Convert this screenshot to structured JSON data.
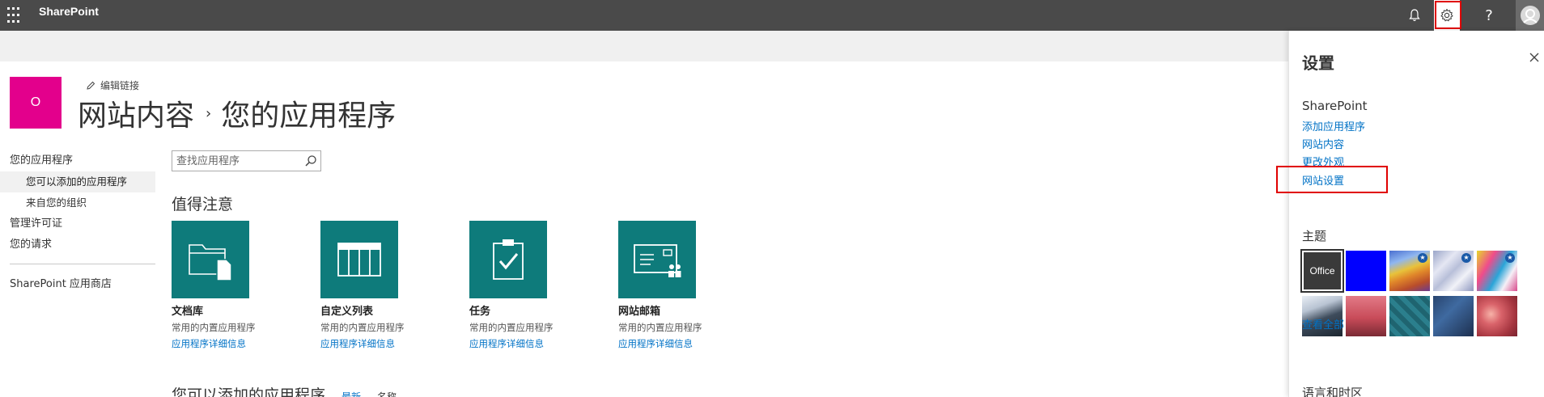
{
  "suite": {
    "app_name": "SharePoint",
    "help_glyph": "?"
  },
  "header": {
    "logo_letter": "O",
    "edit_links": "编辑链接",
    "title_part1": "网站内容",
    "title_sep": "›",
    "title_part2": "您的应用程序"
  },
  "leftnav": {
    "items": [
      {
        "label": "您的应用程序"
      },
      {
        "label": "您可以添加的应用程序"
      },
      {
        "label": "来自您的组织"
      },
      {
        "label": "管理许可证"
      },
      {
        "label": "您的请求"
      },
      {
        "label": "SharePoint 应用商店"
      }
    ]
  },
  "main": {
    "search_placeholder": "查找应用程序",
    "featured_title": "值得注意",
    "apps": [
      {
        "name": "文档库",
        "desc": "常用的内置应用程序",
        "link": "应用程序详细信息",
        "icon": "document-library-icon"
      },
      {
        "name": "自定义列表",
        "desc": "常用的内置应用程序",
        "link": "应用程序详细信息",
        "icon": "custom-list-icon"
      },
      {
        "name": "任务",
        "desc": "常用的内置应用程序",
        "link": "应用程序详细信息",
        "icon": "tasks-icon"
      },
      {
        "name": "网站邮箱",
        "desc": "常用的内置应用程序",
        "link": "应用程序详细信息",
        "icon": "site-mailbox-icon"
      }
    ],
    "bottom_title": "您可以添加的应用程序",
    "sort_newest": "最新",
    "sort_name": "名称"
  },
  "settings": {
    "title": "设置",
    "section_sharepoint": "SharePoint",
    "links": [
      {
        "label": "添加应用程序"
      },
      {
        "label": "网站内容"
      },
      {
        "label": "更改外观"
      },
      {
        "label": "网站设置"
      }
    ],
    "themes_title": "主题",
    "office_theme_label": "Office",
    "view_all": "查看全部",
    "language_title": "语言和时区"
  },
  "colors": {
    "tile_teal": "#0e7b7b",
    "site_logo_magenta": "#e3008c",
    "link_blue": "#0072c6",
    "highlight_red": "#e00000"
  }
}
